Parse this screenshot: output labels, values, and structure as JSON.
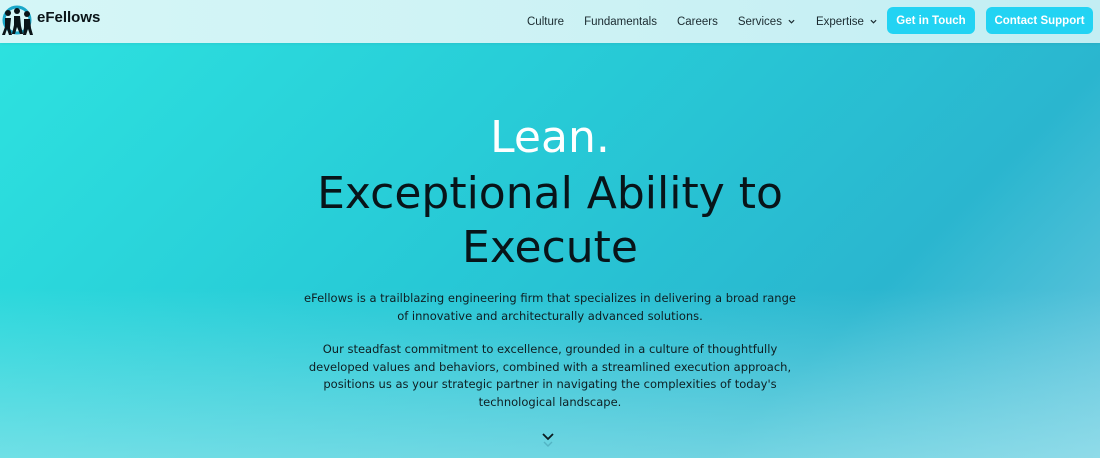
{
  "brand": {
    "name": "eFellows"
  },
  "nav": {
    "items": [
      {
        "label": "Culture"
      },
      {
        "label": "Fundamentals"
      },
      {
        "label": "Careers"
      },
      {
        "label": "Services"
      },
      {
        "label": "Expertise"
      }
    ],
    "get_in_touch": "Get in Touch",
    "contact_support": "Contact Support"
  },
  "hero": {
    "line1": "Lean.",
    "line2": "Exceptional Ability to",
    "line3": "Execute",
    "paragraph1": "eFellows is a trailblazing engineering firm that specializes in delivering a broad range of innovative and architecturally advanced solutions.",
    "paragraph2": "Our steadfast commitment to excellence, grounded in a culture of thoughtfully developed values and behaviors, combined with a streamlined execution approach, positions us as your strategic partner in navigating the complexities of today's technological landscape."
  },
  "colors": {
    "accent": "#22d3f3",
    "background_start": "#2de3e0",
    "background_end": "#2ab6cf"
  },
  "icons": {
    "logo": "people-circle-logo",
    "dropdown": "chevron-down-icon",
    "scroll": "double-chevron-down-icon"
  }
}
